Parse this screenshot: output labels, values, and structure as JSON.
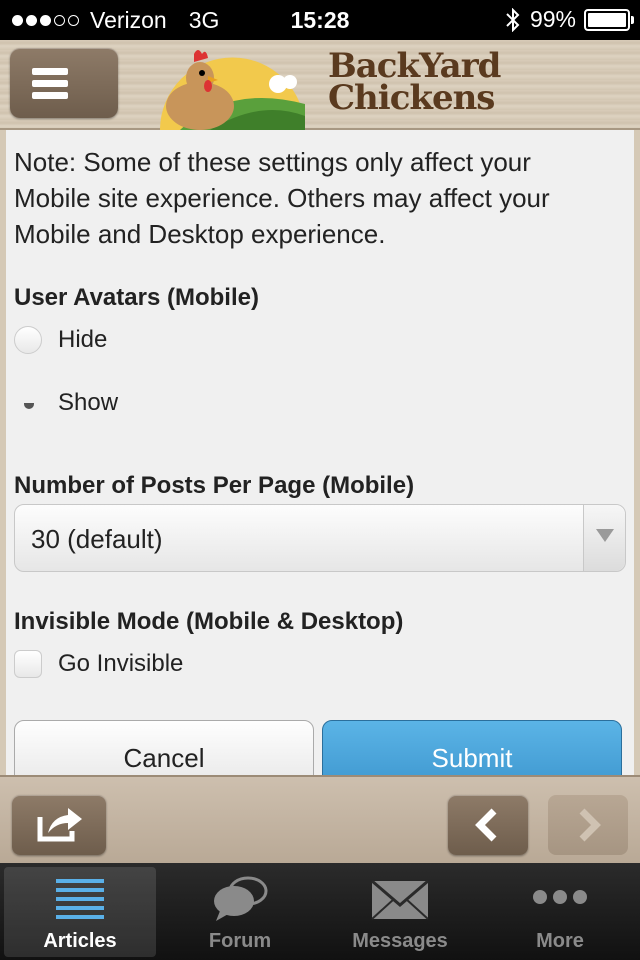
{
  "status_bar": {
    "carrier": "Verizon",
    "network": "3G",
    "time": "15:28",
    "battery": "99%",
    "battery_level": 0.99
  },
  "header": {
    "logo_line1": "BackYard",
    "logo_line2": "Chickens"
  },
  "content": {
    "note": "Note: Some of these settings only affect your Mobile site experience. Others may affect your Mobile and Desktop experience.",
    "avatars": {
      "title": "User Avatars (Mobile)",
      "options": [
        "Hide",
        "Show"
      ],
      "selected": "Show"
    },
    "posts_per_page": {
      "title": "Number of Posts Per Page (Mobile)",
      "selected_value": "30 (default)"
    },
    "invisible": {
      "title": "Invisible Mode (Mobile & Desktop)",
      "checkbox_label": "Go Invisible"
    },
    "cancel_label": "Cancel",
    "submit_label": "Submit"
  },
  "tabbar": {
    "tabs": [
      {
        "label": "Articles",
        "icon": "list-icon",
        "active": true
      },
      {
        "label": "Forum",
        "icon": "speech-bubbles-icon",
        "active": false
      },
      {
        "label": "Messages",
        "icon": "envelope-icon",
        "active": false
      },
      {
        "label": "More",
        "icon": "more-dots-icon",
        "active": false
      }
    ]
  },
  "colors": {
    "submit_blue": "#3a93cc",
    "header_wood": "#d8ccb9",
    "button_brown": "#7d6a58"
  }
}
